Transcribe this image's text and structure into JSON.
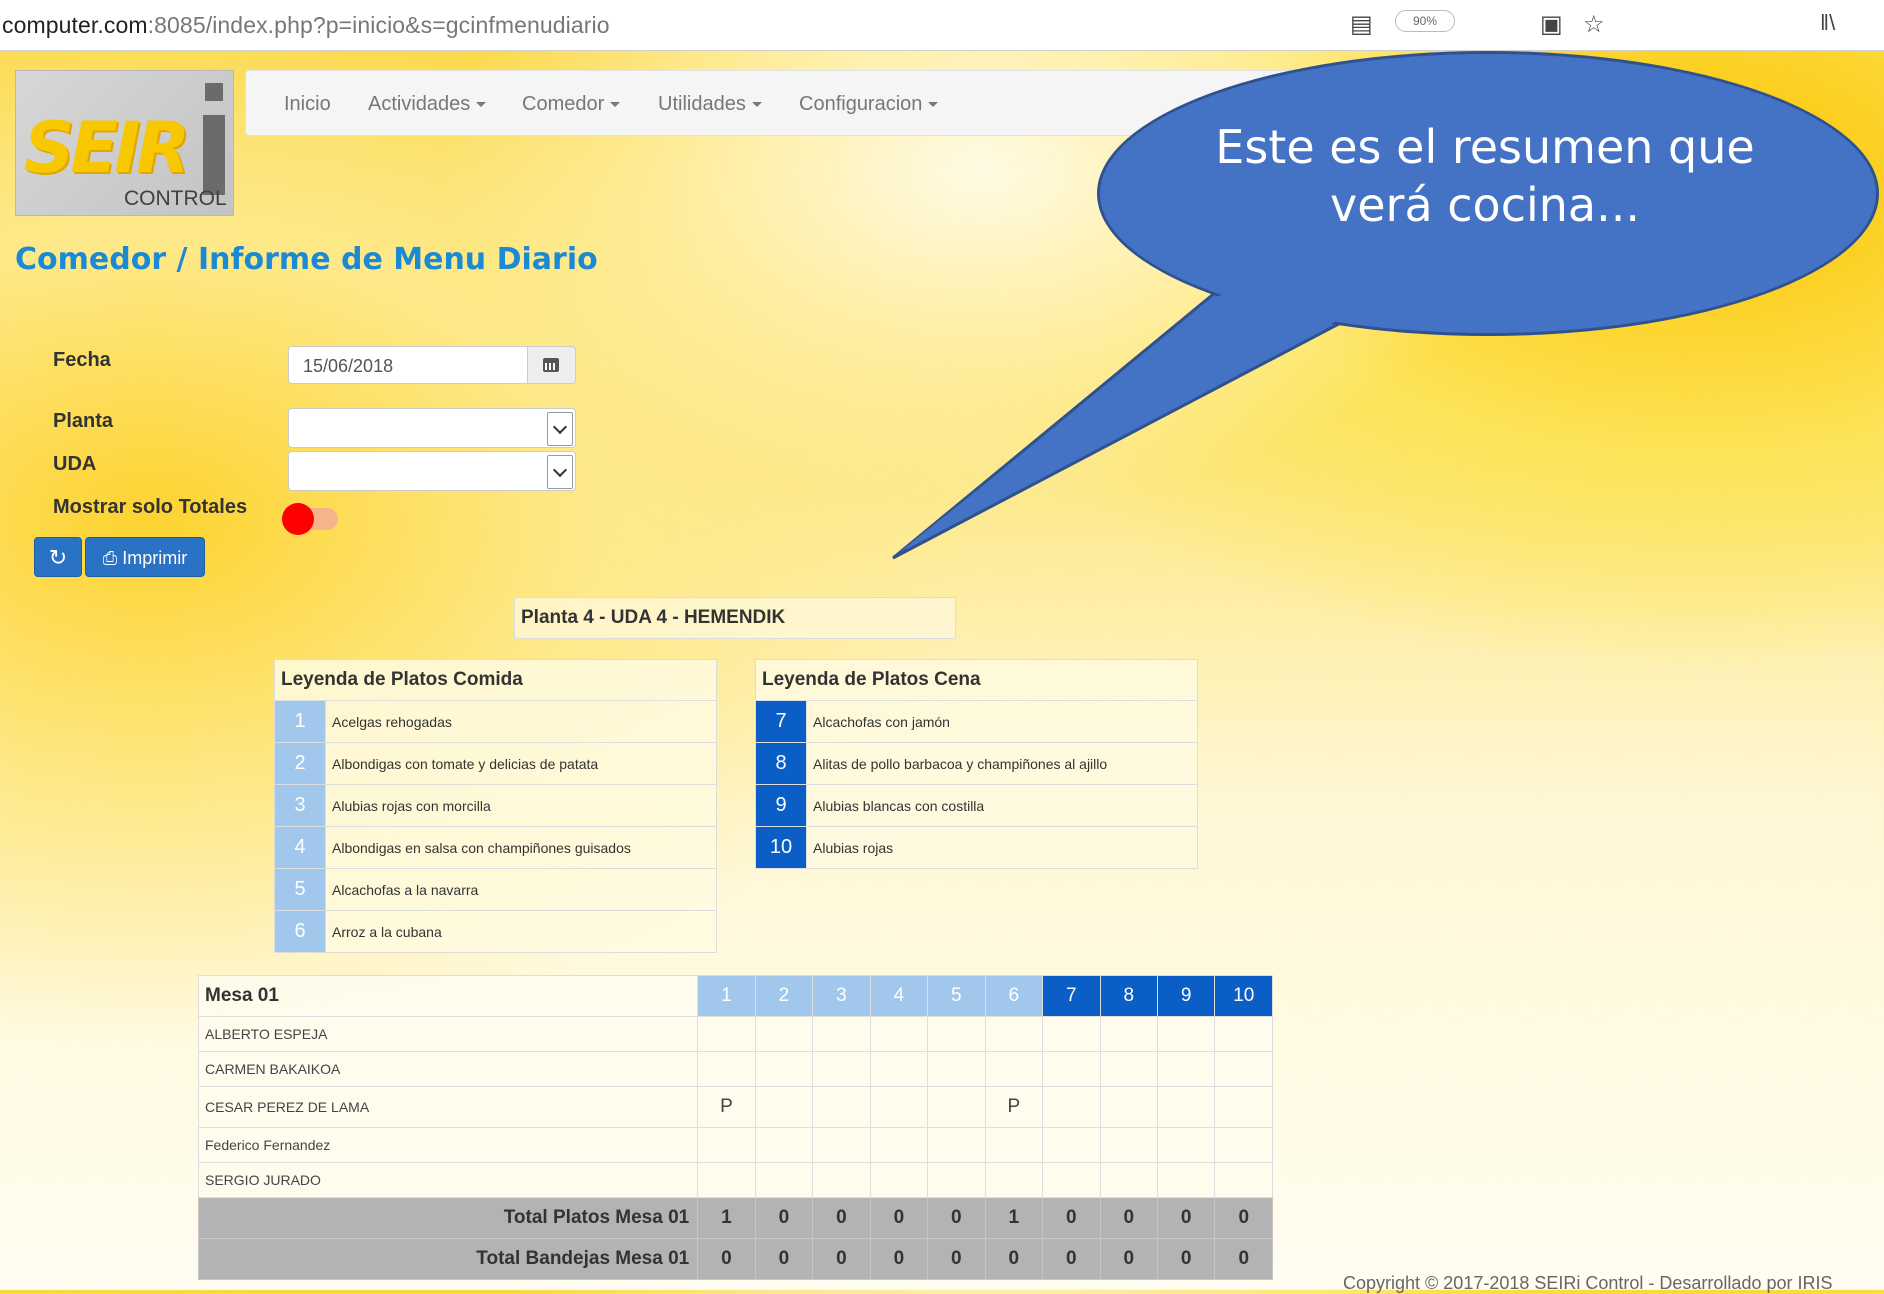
{
  "browser": {
    "url_host": "computer.com",
    "url_rest": ":8085/index.php?p=inicio&s=gcinfmenudiario",
    "zoom": "90%"
  },
  "logo": {
    "text": "SEIR",
    "subtext": "CONTROL"
  },
  "navbar": {
    "items": [
      {
        "label": "Inicio"
      },
      {
        "label": "Actividades"
      },
      {
        "label": "Comedor"
      },
      {
        "label": "Utilidades"
      },
      {
        "label": "Configuracion"
      }
    ]
  },
  "page": {
    "title": "Comedor / Informe de Menu Diario"
  },
  "form": {
    "fecha_label": "Fecha",
    "fecha_value": "15/06/2018",
    "planta_label": "Planta",
    "planta_value": "",
    "uda_label": "UDA",
    "uda_value": "",
    "totales_label": "Mostrar solo Totales",
    "print_label": "Imprimir"
  },
  "bubble": {
    "text": "Este es el resumen que verá cocina..."
  },
  "report": {
    "planta_header": "Planta 4 - UDA 4 - HEMENDIK",
    "comida_title": "Leyenda de Platos Comida",
    "comida": [
      {
        "num": "1",
        "name": "Acelgas rehogadas"
      },
      {
        "num": "2",
        "name": "Albondigas con tomate y delicias de patata"
      },
      {
        "num": "3",
        "name": "Alubias rojas con morcilla"
      },
      {
        "num": "4",
        "name": "Albondigas en salsa con champiñones guisados"
      },
      {
        "num": "5",
        "name": "Alcachofas a la navarra"
      },
      {
        "num": "6",
        "name": "Arroz a la cubana"
      }
    ],
    "cena_title": "Leyenda de Platos Cena",
    "cena": [
      {
        "num": "7",
        "name": "Alcachofas con jamón"
      },
      {
        "num": "8",
        "name": "Alitas de pollo barbacoa y champiñones al ajillo"
      },
      {
        "num": "9",
        "name": "Alubias blancas con costilla"
      },
      {
        "num": "10",
        "name": "Alubias rojas"
      }
    ],
    "mesa_title": "Mesa 01",
    "columns": [
      "1",
      "2",
      "3",
      "4",
      "5",
      "6",
      "7",
      "8",
      "9",
      "10"
    ],
    "rows": [
      {
        "name": "ALBERTO ESPEJA",
        "cells": [
          "",
          "",
          "",
          "",
          "",
          "",
          "",
          "",
          "",
          ""
        ]
      },
      {
        "name": "CARMEN BAKAIKOA",
        "cells": [
          "",
          "",
          "",
          "",
          "",
          "",
          "",
          "",
          "",
          ""
        ]
      },
      {
        "name": "CESAR PEREZ DE LAMA",
        "cells": [
          "P",
          "",
          "",
          "",
          "",
          "P",
          "",
          "",
          "",
          ""
        ]
      },
      {
        "name": "Federico Fernandez",
        "cells": [
          "",
          "",
          "",
          "",
          "",
          "",
          "",
          "",
          "",
          ""
        ]
      },
      {
        "name": "SERGIO JURADO",
        "cells": [
          "",
          "",
          "",
          "",
          "",
          "",
          "",
          "",
          "",
          ""
        ]
      }
    ],
    "total_platos_label": "Total Platos Mesa 01",
    "total_platos": [
      "1",
      "0",
      "0",
      "0",
      "0",
      "1",
      "0",
      "0",
      "0",
      "0"
    ],
    "total_bandejas_label": "Total Bandejas Mesa 01",
    "total_bandejas": [
      "0",
      "0",
      "0",
      "0",
      "0",
      "0",
      "0",
      "0",
      "0",
      "0"
    ]
  },
  "footer": {
    "copyright": "Copyright © 2017-2018 SEIRi Control - Desarrollado por IRIS"
  }
}
